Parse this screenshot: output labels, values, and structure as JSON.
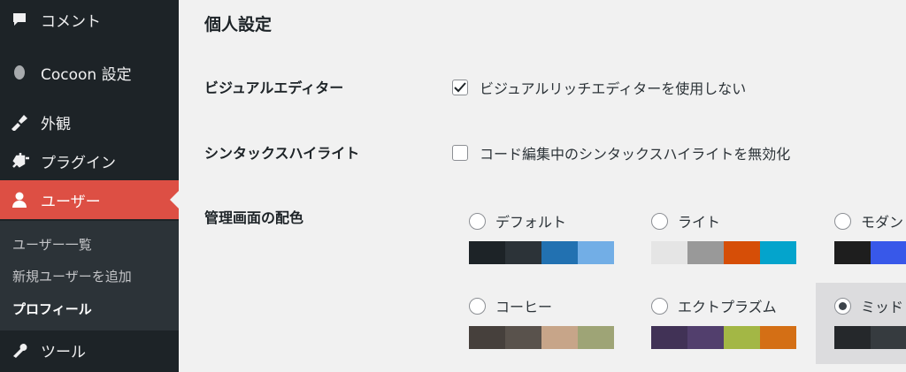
{
  "sidebar": {
    "items": [
      {
        "label": "コメント",
        "icon": "comment-icon"
      },
      {
        "label": "Cocoon 設定",
        "icon": "cocoon-icon"
      },
      {
        "label": "外観",
        "icon": "appearance-icon"
      },
      {
        "label": "プラグイン",
        "icon": "plugin-icon"
      },
      {
        "label": "ユーザー",
        "icon": "user-icon"
      },
      {
        "label": "ツール",
        "icon": "wrench-icon"
      }
    ],
    "submenu": [
      "ユーザー一覧",
      "新規ユーザーを追加",
      "プロフィール"
    ]
  },
  "main": {
    "title": "個人設定",
    "visual_editor": {
      "label": "ビジュアルエディター",
      "option": "ビジュアルリッチエディターを使用しない",
      "checked": true
    },
    "syntax_highlight": {
      "label": "シンタックスハイライト",
      "option": "コード編集中のシンタックスハイライトを無効化",
      "checked": false
    },
    "color_scheme": {
      "label": "管理画面の配色",
      "schemes": [
        {
          "name": "デフォルト",
          "colors": [
            "#1d2327",
            "#2c3338",
            "#2271b1",
            "#72aee6"
          ],
          "selected": false
        },
        {
          "name": "ライト",
          "colors": [
            "#e5e5e5",
            "#999999",
            "#d64e07",
            "#04a4cc"
          ],
          "selected": false
        },
        {
          "name": "モダン",
          "colors": [
            "#1e1e1e",
            "#3858e9"
          ],
          "selected": false
        },
        {
          "name": "コーヒー",
          "colors": [
            "#46403c",
            "#59524c",
            "#c7a589",
            "#9ea476"
          ],
          "selected": false
        },
        {
          "name": "エクトプラズム",
          "colors": [
            "#413256",
            "#523f6d",
            "#a3b745",
            "#d46f15"
          ],
          "selected": false
        },
        {
          "name": "ミッド",
          "colors": [
            "#25282b",
            "#363b3f"
          ],
          "selected": true
        }
      ]
    }
  },
  "colors": {
    "sidebar_bg": "#1d2327",
    "active": "#dd4f44",
    "submenu_bg": "#2c3338"
  }
}
